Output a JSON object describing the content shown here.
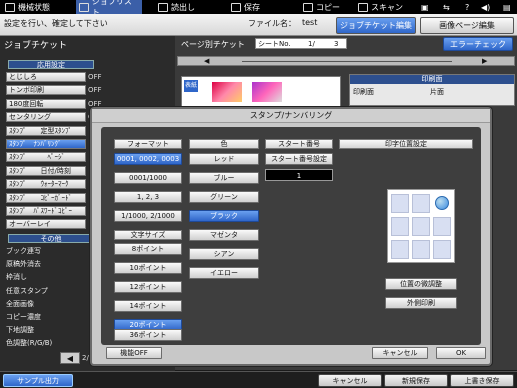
{
  "topbar": {
    "machine_status": "機械状態",
    "job_list": "ジョブリスト",
    "read": "読出し",
    "save": "保存",
    "copy": "コピー",
    "scan": "スキャン"
  },
  "header": {
    "instruction": "設定を行い、確定して下さい",
    "filename_label": "ファイル名：",
    "filename": "test",
    "tab_job_ticket_edit": "ジョブチケット編集",
    "tab_image_page_edit": "画像ページ編集"
  },
  "left": {
    "title": "ジョブチケット",
    "section_applied": "応用設定",
    "items": [
      {
        "label": "とじしろ",
        "value": "OFF"
      },
      {
        "label": "トンボ印刷",
        "value": "OFF"
      },
      {
        "label": "180度回転",
        "value": "OFF"
      },
      {
        "label": "センタリング",
        "value": "OFF"
      },
      {
        "label": "ｽﾀﾝﾌﾟ　　定型ｽﾀﾝﾌﾟ",
        "value": ""
      },
      {
        "label": "ｽﾀﾝﾌﾟ　ﾅﾝﾊﾞﾘﾝｸﾞ",
        "value": ""
      },
      {
        "label": "ｽﾀﾝﾌﾟ　　　ﾍﾟｰｼﾞ",
        "value": ""
      },
      {
        "label": "ｽﾀﾝﾌﾟ　　日付/時刻",
        "value": ""
      },
      {
        "label": "ｽﾀﾝﾌﾟ　　ｳｫｰﾀｰﾏｰｸ",
        "value": ""
      },
      {
        "label": "ｽﾀﾝﾌﾟ　　ｺﾋﾟｰｶﾞｰﾄﾞ",
        "value": ""
      },
      {
        "label": "ｽﾀﾝﾌﾟ　ﾊﾟｽﾜｰﾄﾞｺﾋﾟｰ",
        "value": ""
      },
      {
        "label": "オーバーレイ",
        "value": ""
      }
    ],
    "section_other": "その他",
    "other_items": [
      "ブック連写",
      "原稿外消去",
      "枠消し",
      "任意スタンプ",
      "全面画像",
      "コピー濃度",
      "下地調整",
      "色調整(R/G/B)"
    ],
    "pager": "2/"
  },
  "right": {
    "page_ticket_label": "ページ別チケット",
    "sheet_no_label": "シートNo.",
    "sheet_no": "1/",
    "sheet_total": "3",
    "error_check": "エラーチェック",
    "print_side_head": "印刷面",
    "print_side_label": "印刷面",
    "print_side_value": "片面",
    "thumb_label": "表紙"
  },
  "dialog": {
    "title": "スタンプ/ナンバリング",
    "format_head": "フォーマット",
    "formats": [
      "0001, 0002, 0003",
      "0001/1000",
      "1, 2, 3",
      "1/1000, 2/1000"
    ],
    "font_size_head": "文字サイズ",
    "font_sizes": [
      "8ポイント",
      "10ポイント",
      "12ポイント",
      "14ポイント",
      "20ポイント",
      "36ポイント"
    ],
    "color_head": "色",
    "colors": [
      "レッド",
      "ブルー",
      "グリーン",
      "ブラック",
      "マゼンタ",
      "シアン",
      "イエロー"
    ],
    "start_head": "スタート番号",
    "start_btn": "スタート番号設定",
    "start_value": "1",
    "position_head": "印字位置設定",
    "fine_adjust": "位置の微調整",
    "outside_print": "外側印刷",
    "function_off": "機能OFF",
    "cancel": "キャンセル",
    "ok": "OK"
  },
  "bottom": {
    "sample_output": "サンプル出力",
    "cancel": "キャンセル",
    "save_new": "新規保存",
    "overwrite": "上書き保存"
  }
}
